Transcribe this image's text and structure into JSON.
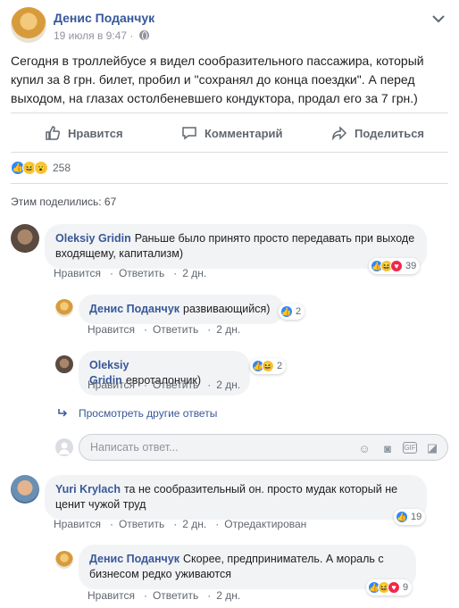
{
  "post": {
    "author": "Денис Поданчук",
    "date": "19 июля в 9:47",
    "text": "Сегодня в троллейбусе я видел сообразительного пассажира, который купил за 8 грн. билет, пробил и \"сохранял до конца поездки\". А перед выходом, на глазах остолбеневшего кондуктора, продал его за 7 грн.)"
  },
  "actions": {
    "like": "Нравится",
    "comment": "Комментарий",
    "share": "Поделиться"
  },
  "reactions": {
    "count": "258"
  },
  "shares": "Этим поделились: 67",
  "comments": [
    {
      "name": "Oleksiy Gridin",
      "text": "Раньше было принято просто передавать при выходе входящему, капитализм)",
      "links": {
        "like": "Нравится",
        "reply": "Ответить",
        "time": "2 дн."
      },
      "reactions": "39"
    },
    {
      "name": "Денис Поданчук",
      "text": "развивающийся)",
      "links": {
        "like": "Нравится",
        "reply": "Ответить",
        "time": "2 дн."
      },
      "reactions": "2"
    },
    {
      "name": "Oleksiy Gridin",
      "text": "евроталончик)",
      "links": {
        "like": "Нравится",
        "reply": "Ответить",
        "time": "2 дн."
      },
      "reactions": "2"
    },
    {
      "name": "Yuri Krylach",
      "text": "та не сообразительный он. просто мудак который не ценит чужой труд",
      "links": {
        "like": "Нравится",
        "reply": "Ответить",
        "time": "2 дн.",
        "edited": "Отредактирован"
      },
      "reactions": "19"
    },
    {
      "name": "Денис Поданчук",
      "text": "Скорее, предприниматель. А мораль с бизнесом редко уживаются",
      "links": {
        "like": "Нравится",
        "reply": "Ответить",
        "time": "2 дн."
      },
      "reactions": "9"
    }
  ],
  "more_replies": "Просмотреть другие ответы",
  "reply_placeholder": "Написать ответ...",
  "colors": {
    "link": "#385898",
    "like_blue": "#2d88ff",
    "love_red": "#f0284a",
    "haha_yellow": "#f7c83a"
  },
  "icons": [
    "chevron-down-icon",
    "globe-icon",
    "thumbs-up-icon",
    "comment-icon",
    "share-icon",
    "reply-arrow-icon",
    "emoji-icon",
    "camera-icon",
    "gif-icon",
    "sticker-icon"
  ]
}
